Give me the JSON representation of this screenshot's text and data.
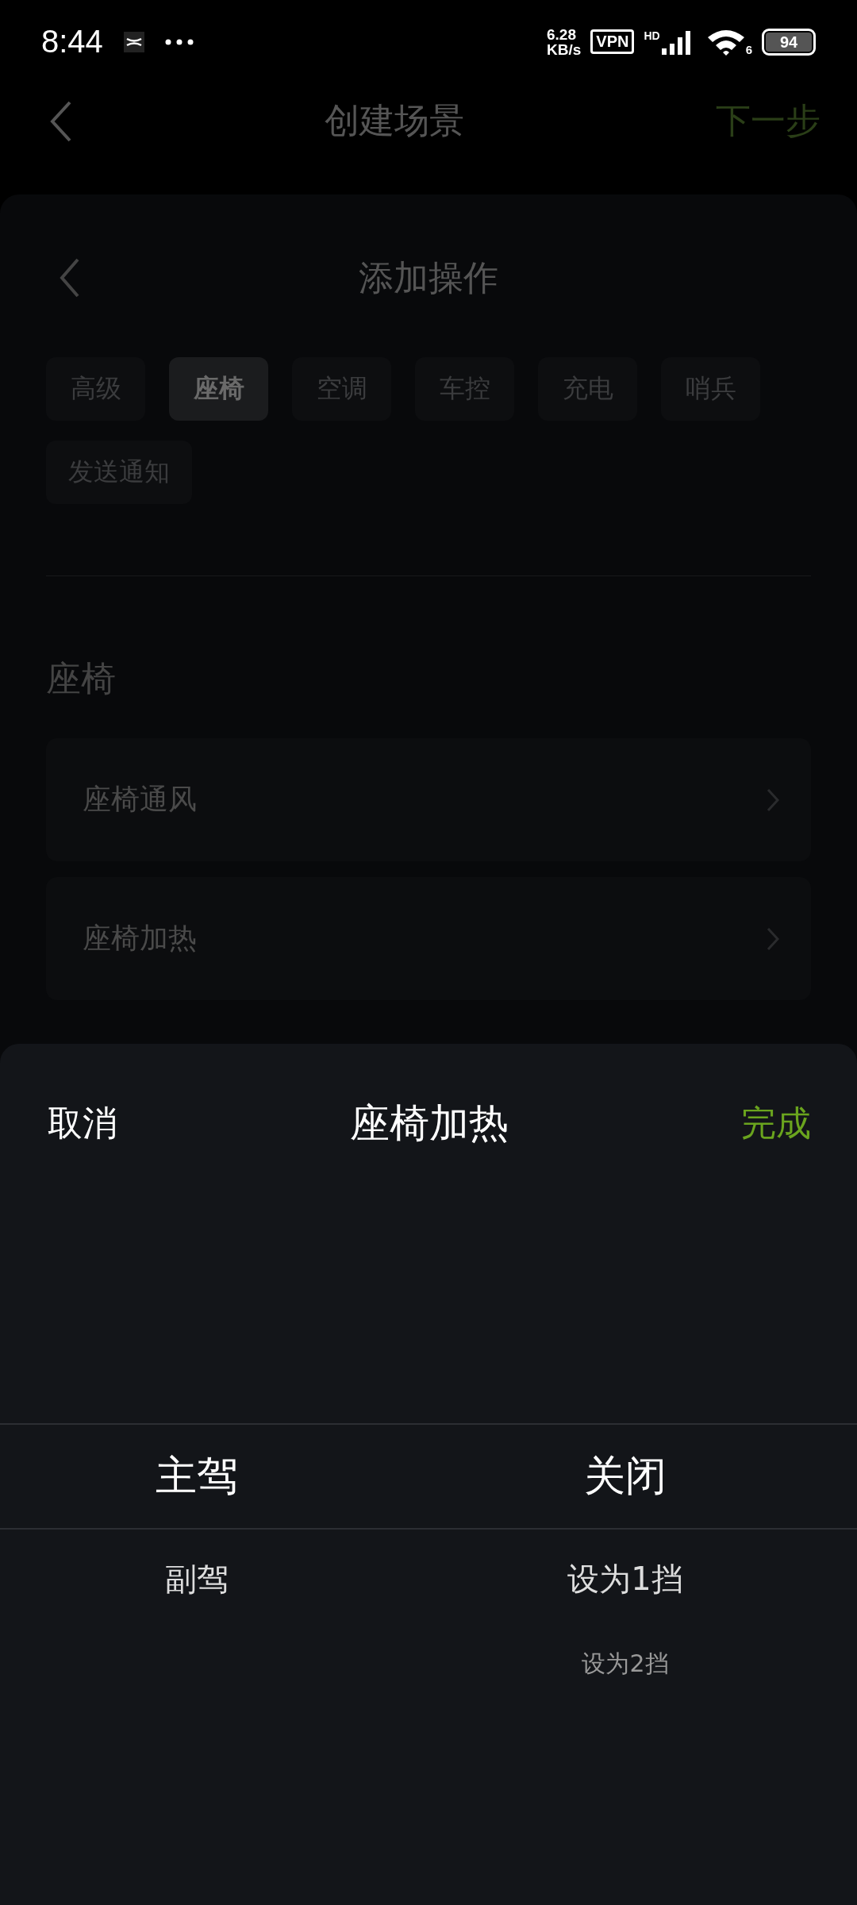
{
  "status_bar": {
    "time": "8:44",
    "speed_value": "6.28",
    "speed_unit": "KB/s",
    "vpn": "VPN",
    "network": "HD",
    "wifi_band": "6",
    "battery": "94"
  },
  "nav": {
    "title": "创建场景",
    "action": "下一步"
  },
  "panel": {
    "title": "添加操作",
    "tabs": [
      {
        "label": "高级",
        "selected": false
      },
      {
        "label": "座椅",
        "selected": true
      },
      {
        "label": "空调",
        "selected": false
      },
      {
        "label": "车控",
        "selected": false
      },
      {
        "label": "充电",
        "selected": false
      },
      {
        "label": "哨兵",
        "selected": false
      },
      {
        "label": "发送通知",
        "selected": false
      }
    ],
    "section_title": "座椅",
    "items": [
      {
        "label": "座椅通风"
      },
      {
        "label": "座椅加热"
      }
    ]
  },
  "sheet": {
    "cancel": "取消",
    "title": "座椅加热",
    "done": "完成",
    "columns": [
      {
        "options": [
          {
            "label": "主驾",
            "selected": true
          },
          {
            "label": "副驾",
            "selected": false
          }
        ]
      },
      {
        "options": [
          {
            "label": "关闭",
            "selected": true
          },
          {
            "label": "设为1挡",
            "selected": false
          },
          {
            "label": "设为2挡",
            "selected": false
          }
        ]
      }
    ]
  }
}
